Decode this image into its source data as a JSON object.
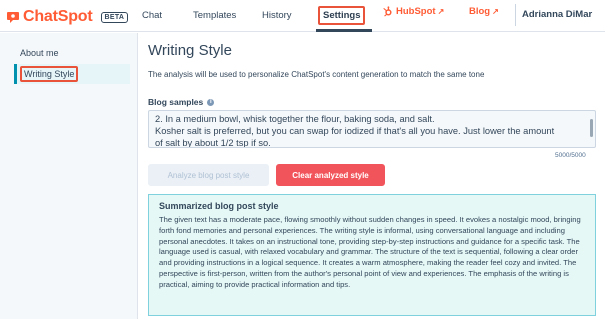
{
  "app": {
    "name": "ChatSpot",
    "badge": "BETA"
  },
  "nav": {
    "chat": "Chat",
    "templates": "Templates",
    "history": "History",
    "settings": "Settings"
  },
  "external": {
    "hubspot": "HubSpot",
    "blog": "Blog"
  },
  "user": {
    "name": "Adrianna DiMar"
  },
  "sidebar": {
    "items": [
      {
        "label": "About me"
      },
      {
        "label": "Writing Style"
      }
    ]
  },
  "main": {
    "title": "Writing Style",
    "description": "The analysis will be used to personalize ChatSpot's content generation to match the same tone",
    "samples_label": "Blog samples",
    "samples_lines": [
      "2. In a medium bowl, whisk together the flour, baking soda, and salt.",
      "Kosher salt is preferred, but you can swap for iodized if that's all you have. Just lower the amount",
      "of salt by about 1/2 tsp if so."
    ],
    "counter": "5000/5000",
    "analyze_button": "Analyze blog post style",
    "clear_button": "Clear analyzed style",
    "summary_title": "Summarized blog post style",
    "summary_text": "The given text has a moderate pace, flowing smoothly without sudden changes in speed. It evokes a nostalgic mood, bringing forth fond memories and personal experiences. The writing style is informal, using conversational language and including personal anecdotes. It takes on an instructional tone, providing step-by-step instructions and guidance for a specific task. The language used is casual, with relaxed vocabulary and grammar. The structure of the text is sequential, following a clear order and providing instructions in a logical sequence. It creates a warm atmosphere, making the reader feel cozy and invited. The perspective is first-person, written from the author's personal point of view and experiences. The emphasis of the writing is practical, aiming to provide practical information and tips."
  },
  "colors": {
    "brand": "#ff5c35",
    "highlight": "#e8533a",
    "danger": "#f2545b",
    "summary_bg": "#e5f8f6"
  }
}
